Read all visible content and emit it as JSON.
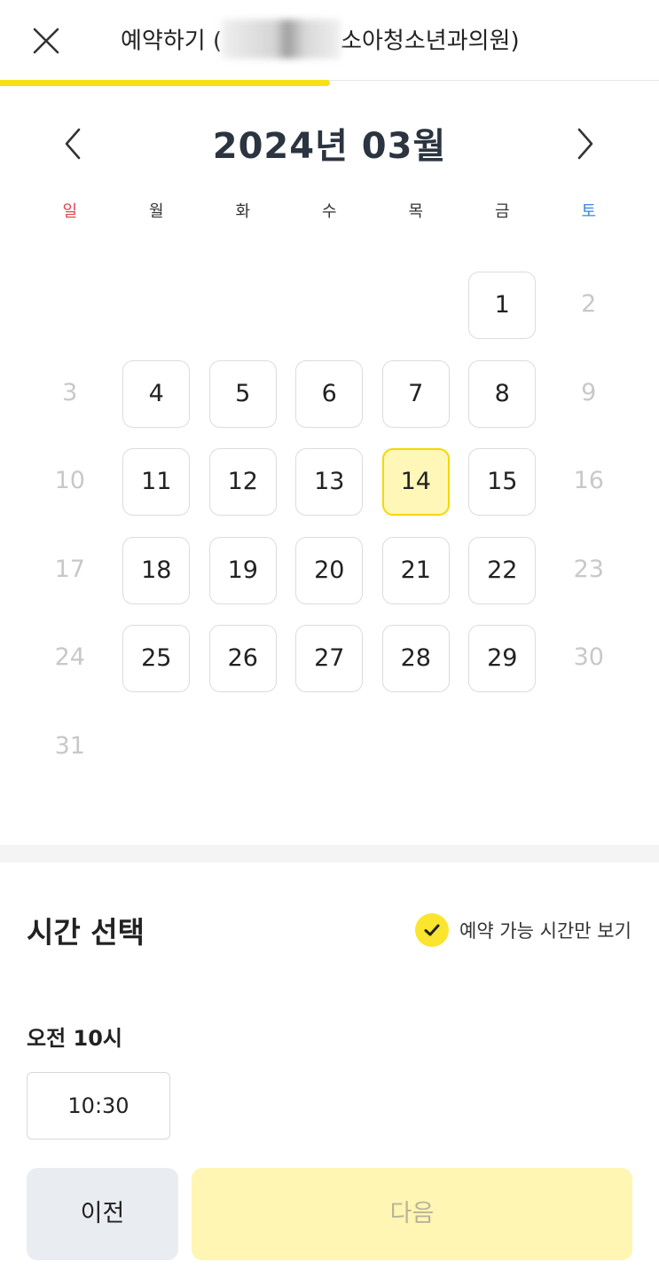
{
  "header": {
    "title_prefix": "예약하기 (",
    "title_suffix": "소아청소년과의원)"
  },
  "progress": {
    "fraction": 0.5,
    "color": "#f7e01b"
  },
  "calendar": {
    "month_title": "2024년 03월",
    "weekdays": [
      "일",
      "월",
      "화",
      "수",
      "목",
      "금",
      "토"
    ],
    "weekday_colors": {
      "sunday": "#e0454d",
      "saturday": "#3b82e8",
      "default": "#333333"
    },
    "first_weekday_index": 5,
    "days_in_month": 31,
    "available_days": [
      1,
      4,
      5,
      6,
      7,
      8,
      11,
      12,
      13,
      14,
      15,
      18,
      19,
      20,
      21,
      22,
      25,
      26,
      27,
      28,
      29
    ],
    "selected_day": 14,
    "selected_color": "#fff7b8"
  },
  "time_section": {
    "title": "시간 선택",
    "toggle_label": "예약 가능 시간만 보기",
    "toggle_checked": true,
    "hour_label": "오전 10시",
    "slots": [
      "10:30"
    ]
  },
  "footer": {
    "prev_label": "이전",
    "next_label": "다음"
  }
}
